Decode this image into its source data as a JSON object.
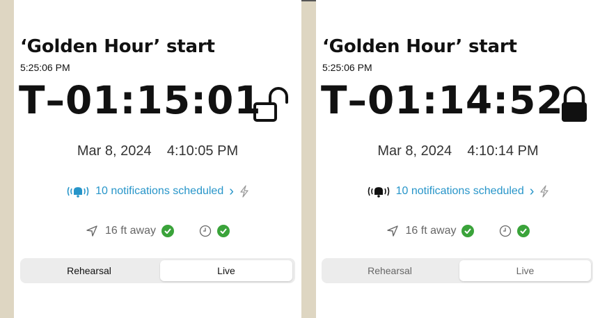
{
  "panels": [
    {
      "title": "‘Golden Hour’ start",
      "time": "5:25:06 PM",
      "countdown": "T–01:15:01",
      "lock_state": "unlocked",
      "date": "Mar 8, 2024",
      "clock": "4:10:05 PM",
      "notifications": "10 notifications scheduled",
      "distance": "16 ft away",
      "segments": [
        "Rehearsal",
        "Live"
      ],
      "selected_segment": "Live"
    },
    {
      "title": "‘Golden Hour’ start",
      "time": "5:25:06 PM",
      "countdown": "T–01:14:52",
      "lock_state": "locked",
      "date": "Mar 8, 2024",
      "clock": "4:10:14 PM",
      "notifications": "10 notifications scheduled",
      "distance": "16 ft away",
      "segments": [
        "Rehearsal",
        "Live"
      ],
      "selected_segment": "Live"
    }
  ],
  "colors": {
    "accent": "#2795c9",
    "success": "#3aa33a",
    "text": "#111111",
    "background": "#ded6c2"
  },
  "icons": [
    "bell-icon",
    "chevron-right-icon",
    "bolt-icon",
    "location-arrow-icon",
    "clock-icon",
    "check-icon",
    "lock-open-icon",
    "lock-icon"
  ]
}
